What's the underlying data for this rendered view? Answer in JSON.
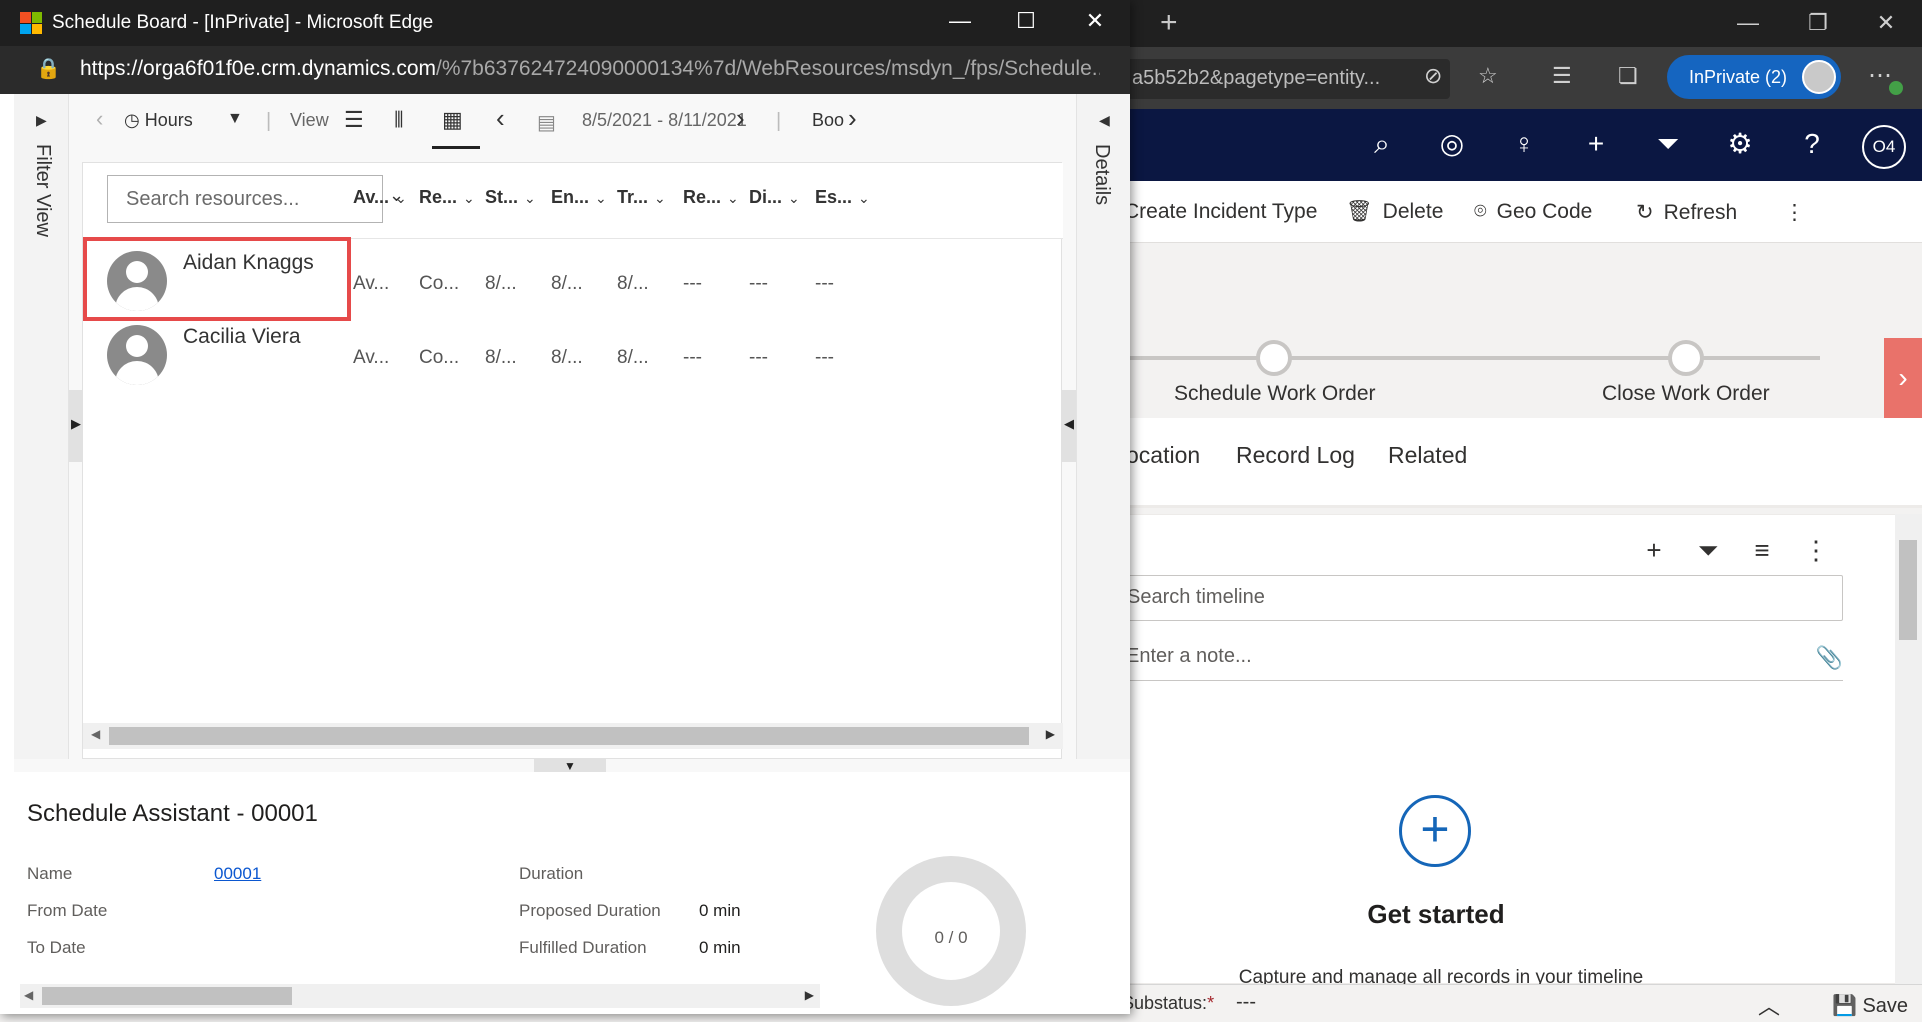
{
  "background_browser": {
    "new_tab_symbol": "+",
    "window_controls": [
      "—",
      "❐",
      "✕"
    ],
    "url_fragment": "a5b52b2&pagetype=entity...",
    "inprivate_label": "InPrivate (2)"
  },
  "crm_nav": {
    "user_initials": "O4"
  },
  "commands": {
    "create_incident_type": "Create Incident Type",
    "delete": "Delete",
    "geo_code": "Geo Code",
    "refresh": "Refresh",
    "more": "⋮"
  },
  "process_flow": {
    "stages": [
      "Schedule Work Order",
      "Close Work Order"
    ]
  },
  "form_tabs": [
    "ocation",
    "Record Log",
    "Related"
  ],
  "timeline": {
    "search_placeholder": "Search timeline",
    "note_placeholder": "Enter a note...",
    "get_started": "Get started",
    "capture_text": "Capture and manage all records in your timeline"
  },
  "footer": {
    "substatus_label": "Substatus:",
    "substatus_required": "*",
    "substatus_value": "---",
    "save_label": "Save"
  },
  "popup": {
    "title": "Schedule Board - [InPrivate] - Microsoft Edge",
    "url_host": "https://orga6f01f0e.crm.dynamics.com",
    "url_path": "/%7b637624724090000134%7d/WebResources/msdyn_/fps/Schedule...",
    "ms_logo_colors": [
      "#f25022",
      "#7fba00",
      "#00a4ef",
      "#ffb900"
    ]
  },
  "schedule_board": {
    "filter_view_label": "Filter View",
    "details_label": "Details",
    "toolbar": {
      "time_scale": "Hours",
      "separator": "|",
      "view_label": "View",
      "date_range": "8/5/2021 - 8/11/2021",
      "book_label": "Boo"
    },
    "search_placeholder": "Search resources...",
    "columns": [
      "Av...",
      "Re...",
      "St...",
      "En...",
      "Tr...",
      "Re...",
      "Di...",
      "Es..."
    ],
    "resources": [
      {
        "name": "Aidan Knaggs",
        "highlighted": true,
        "cells": [
          "Av...",
          "Co...",
          "8/...",
          "8/...",
          "8/...",
          "---",
          "---",
          "---"
        ]
      },
      {
        "name": "Cacilia Viera",
        "highlighted": false,
        "cells": [
          "Av...",
          "Co...",
          "8/...",
          "8/...",
          "8/...",
          "---",
          "---",
          "---"
        ]
      }
    ]
  },
  "schedule_assistant": {
    "title": "Schedule Assistant - 00001",
    "name_label": "Name",
    "name_value": "00001",
    "from_date_label": "From Date",
    "to_date_label": "To Date",
    "duration_label": "Duration",
    "proposed_duration_label": "Proposed Duration",
    "proposed_duration_value": "0 min",
    "fulfilled_duration_label": "Fulfilled Duration",
    "fulfilled_duration_value": "0 min",
    "progress_text": "0 / 0"
  }
}
